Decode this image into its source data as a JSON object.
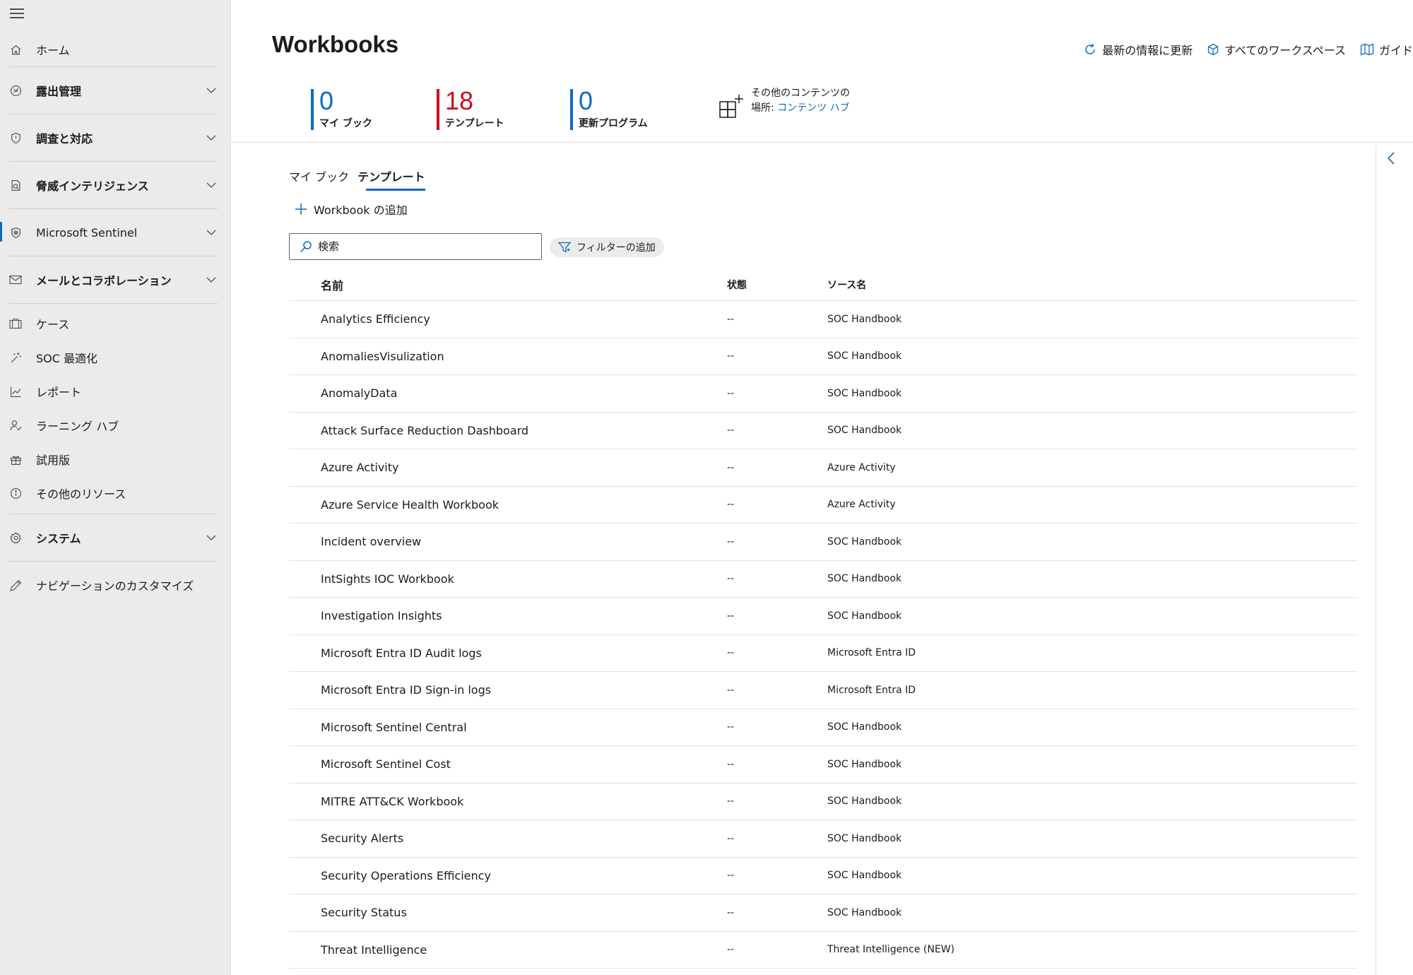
{
  "sidebar": {
    "items": [
      {
        "label": "ホーム",
        "icon": "home-icon",
        "type": "item"
      },
      {
        "label": "露出管理",
        "icon": "exposure-icon",
        "type": "group"
      },
      {
        "label": "調査と対応",
        "icon": "shield-icon",
        "type": "group"
      },
      {
        "label": "脅威インテリジェンス",
        "icon": "threat-intel-icon",
        "type": "group"
      },
      {
        "label": "Microsoft Sentinel",
        "icon": "sentinel-icon",
        "type": "group",
        "active": true
      },
      {
        "label": "メールとコラボレーション",
        "icon": "mail-icon",
        "type": "group"
      },
      {
        "label": "ケース",
        "icon": "briefcase-icon",
        "type": "item"
      },
      {
        "label": "SOC 最適化",
        "icon": "magic-wand-icon",
        "type": "item"
      },
      {
        "label": "レポート",
        "icon": "chart-icon",
        "type": "item"
      },
      {
        "label": "ラーニング ハブ",
        "icon": "learning-icon",
        "type": "item"
      },
      {
        "label": "試用版",
        "icon": "gift-icon",
        "type": "item"
      },
      {
        "label": "その他のリソース",
        "icon": "info-icon",
        "type": "item"
      },
      {
        "label": "システム",
        "icon": "gear-icon",
        "type": "group"
      },
      {
        "label": "ナビゲーションのカスタマイズ",
        "icon": "pencil-icon",
        "type": "item"
      }
    ]
  },
  "header": {
    "title": "Workbooks",
    "actions": {
      "refresh": "最新の情報に更新",
      "workspaces": "すべてのワークスペース",
      "guide": "ガイド"
    }
  },
  "stats": {
    "my": {
      "value": "0",
      "label": "マイ ブック"
    },
    "templates": {
      "value": "18",
      "label": "テンプレート"
    },
    "updates": {
      "value": "0",
      "label": "更新プログラム"
    }
  },
  "content_hub": {
    "text": "その他のコンテンツの場所: ",
    "link": "コンテンツ ハブ"
  },
  "tabs": {
    "my": "マイ ブック",
    "templates": "テンプレート"
  },
  "toolbar": {
    "add_label": "Workbook の追加",
    "search_placeholder": "検索",
    "filter_label": "フィルターの追加"
  },
  "colors": {
    "accent": "#0f6cbd",
    "templates_accent": "#c50f1f",
    "sidebar_bg": "#ebebeb"
  },
  "table": {
    "headers": {
      "name": "名前",
      "state": "状態",
      "source": "ソース名"
    },
    "rows": [
      {
        "name": "Analytics Efficiency",
        "state": "--",
        "source": "SOC Handbook"
      },
      {
        "name": "AnomaliesVisulization",
        "state": "--",
        "source": "SOC Handbook"
      },
      {
        "name": "AnomalyData",
        "state": "--",
        "source": "SOC Handbook"
      },
      {
        "name": "Attack Surface Reduction Dashboard",
        "state": "--",
        "source": "SOC Handbook"
      },
      {
        "name": "Azure Activity",
        "state": "--",
        "source": "Azure Activity"
      },
      {
        "name": "Azure Service Health Workbook",
        "state": "--",
        "source": "Azure Activity"
      },
      {
        "name": "Incident overview",
        "state": "--",
        "source": "SOC Handbook"
      },
      {
        "name": "IntSights IOC Workbook",
        "state": "--",
        "source": "SOC Handbook"
      },
      {
        "name": "Investigation Insights",
        "state": "--",
        "source": "SOC Handbook"
      },
      {
        "name": "Microsoft Entra ID Audit logs",
        "state": "--",
        "source": "Microsoft Entra ID"
      },
      {
        "name": "Microsoft Entra ID Sign-in logs",
        "state": "--",
        "source": "Microsoft Entra ID"
      },
      {
        "name": "Microsoft Sentinel Central",
        "state": "--",
        "source": "SOC Handbook"
      },
      {
        "name": "Microsoft Sentinel Cost",
        "state": "--",
        "source": "SOC Handbook"
      },
      {
        "name": "MITRE ATT&CK Workbook",
        "state": "--",
        "source": "SOC Handbook"
      },
      {
        "name": "Security Alerts",
        "state": "--",
        "source": "SOC Handbook"
      },
      {
        "name": "Security Operations Efficiency",
        "state": "--",
        "source": "SOC Handbook"
      },
      {
        "name": "Security Status",
        "state": "--",
        "source": "SOC Handbook"
      },
      {
        "name": "Threat Intelligence",
        "state": "--",
        "source": "Threat Intelligence (NEW)"
      }
    ]
  }
}
